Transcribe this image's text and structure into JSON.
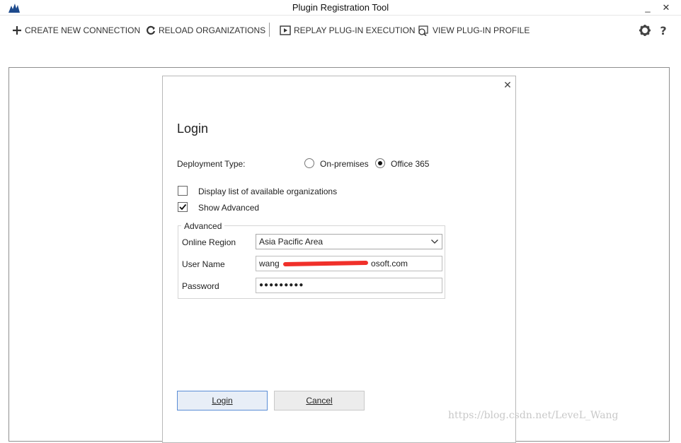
{
  "window": {
    "title": "Plugin Registration Tool",
    "minimize_glyph": "_",
    "close_glyph": "✕"
  },
  "toolbar": {
    "create_connection": "CREATE NEW CONNECTION",
    "reload_organizations": "RELOAD ORGANIZATIONS",
    "replay_plugin": "REPLAY PLUG-IN EXECUTION",
    "view_profile": "VIEW PLUG-IN PROFILE",
    "icons": [
      "plus-icon",
      "reload-icon",
      "play-icon",
      "profile-icon",
      "gear-icon",
      "help-icon"
    ]
  },
  "dialog": {
    "close_glyph": "✕",
    "heading": "Login",
    "deployment_type_label": "Deployment Type:",
    "deployment_options": [
      {
        "label": "On-premises",
        "selected": false
      },
      {
        "label": "Office 365",
        "selected": true
      }
    ],
    "display_orgs_label": "Display list of available organizations",
    "display_orgs_checked": false,
    "show_advanced_label": "Show Advanced",
    "show_advanced_checked": true,
    "advanced": {
      "legend": "Advanced",
      "online_region_label": "Online Region",
      "online_region_value": "Asia Pacific Area",
      "user_name_label": "User Name",
      "user_name_value_start": "wang",
      "user_name_value_end": "osoft.com",
      "password_label": "Password",
      "password_mask": "●●●●●●●●●"
    },
    "login_button": "Login",
    "cancel_button": "Cancel"
  },
  "watermark": "https://blog.csdn.net/LeveL_Wang",
  "colors": {
    "login_border": "#5a8dd6",
    "redaction": "#f0302a"
  }
}
